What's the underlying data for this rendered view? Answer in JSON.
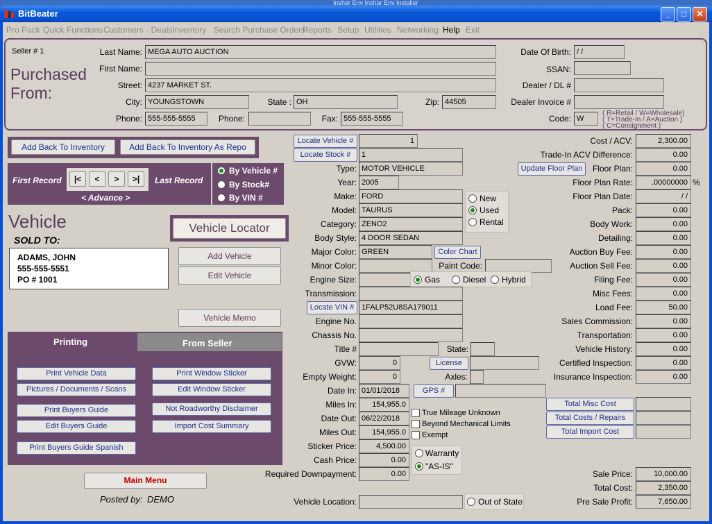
{
  "window": {
    "title": "BitBeater",
    "ghost_text": "Inshar Env     Inshar Env      Installer"
  },
  "menu": [
    "Pro Pack",
    "Quick Functions",
    "Customers - Deals",
    "Inventory",
    "Search Purchase Orders",
    "Reports",
    "Setup",
    "Utilities",
    "Networking",
    "Help",
    "Exit"
  ],
  "seller": {
    "seller_no": "Seller # 1",
    "purchased_from": "Purchased From:",
    "last_name_label": "Last Name:",
    "last_name": "MEGA AUTO AUCTION",
    "first_name_label": "First Name:",
    "first_name": "",
    "street_label": "Street:",
    "street": "4237 MARKET ST.",
    "city_label": "City:",
    "city": "YOUNGSTOWN",
    "state_label": "State :",
    "state": "OH",
    "zip_label": "Zip:",
    "zip": "44505",
    "phone_label": "Phone:",
    "phone": "555-555-5555",
    "phone2_label": "Phone:",
    "phone2": "",
    "fax_label": "Fax:",
    "fax": "555-555-5555",
    "dob_label": "Date Of Birth:",
    "dob": " / /",
    "ssan_label": "SSAN:",
    "ssan": "",
    "dealer_dl_label": "Dealer / DL #",
    "dealer_dl": "",
    "dealer_invoice_label": "Dealer Invoice #",
    "dealer_invoice": "",
    "code_label": "Code:",
    "code": "W",
    "code_hint1": "( R=Retail  /  W=Wholesale)",
    "code_hint2": "( T=Trade-In / A=Auction )",
    "code_hint3": "( C=Consignment )"
  },
  "left": {
    "add_back": "Add Back To Inventory",
    "add_back_repo": "Add Back To Inventory As Repo",
    "first_record": "First Record",
    "last_record": "Last Record",
    "advance": "< Advance >",
    "nav": [
      "|<",
      "<",
      ">",
      ">|"
    ],
    "by_vehicle": "By Vehicle #",
    "by_stock": "By Stock#",
    "by_vin": "By VIN #",
    "vehicle": "Vehicle",
    "sold_to": "SOLD TO:",
    "buyer_name": "ADAMS, JOHN",
    "buyer_phone": "555-555-5551",
    "buyer_po": "PO # 1001",
    "vehicle_locator": "Vehicle Locator",
    "add_vehicle": "Add Vehicle",
    "edit_vehicle": "Edit Vehicle",
    "vehicle_memo": "Vehicle Memo",
    "tab_printing": "Printing",
    "tab_from_seller": "From Seller",
    "print_buttons": [
      "Print Vehicle Data",
      "Print Window Sticker",
      "Pictures / Documents / Scans",
      "Edit Window Sticker",
      "Print Buyers Guide",
      "Not Roadworthy Disclaimer",
      "Edit Buyers Guide",
      "Import Cost Summary",
      "Print Buyers Guide Spanish"
    ],
    "main_menu": "Main Menu",
    "posted_by_label": "Posted by:",
    "posted_by": "DEMO"
  },
  "mid": {
    "locate_vehicle": "Locate Vehicle #",
    "vehicle_no": "1",
    "locate_stock": "Locate Stock #",
    "stock_no": "1",
    "type_label": "Type:",
    "type": "MOTOR VEHICLE",
    "year_label": "Year:",
    "year": "2005",
    "make_label": "Make:",
    "make": "FORD",
    "model_label": "Model:",
    "model": "TAURUS",
    "category_label": "Category:",
    "category": "ZENO2",
    "body_label": "Body Style:",
    "body": "4 DOOR SEDAN",
    "major_color_label": "Major Color:",
    "major_color": "GREEN",
    "color_chart": "Color Chart",
    "minor_color_label": "Minor Color:",
    "minor_color": "",
    "paint_code_label": "Paint Code:",
    "paint_code": "",
    "engine_size_label": "Engine Size:",
    "engine_size": "",
    "fuel": [
      "Gas",
      "Diesel",
      "Hybrid"
    ],
    "transmission_label": "Transmission:",
    "transmission": "",
    "locate_vin": "Locate VIN #",
    "vin": "1FALP52U8SA179011",
    "engine_no_label": "Engine No.",
    "engine_no": "",
    "chassis_label": "Chassis No.",
    "chassis": "",
    "title_label": "Title #",
    "title": "",
    "title_state_label": "State:",
    "title_state": "",
    "gvw_label": "GVW:",
    "gvw": "0",
    "license": "License",
    "license_val": "",
    "empty_weight_label": "Empty Weight:",
    "empty_weight": "0",
    "axles_label": "Axles:",
    "axles": "",
    "date_in_label": "Date In:",
    "date_in": "01/01/2018",
    "gps": "GPS #",
    "gps_val": "",
    "miles_in_label": "Miles In:",
    "miles_in": "154,955.0",
    "date_out_label": "Date Out:",
    "date_out": "06/22/2018",
    "miles_out_label": "Miles Out:",
    "miles_out": "154,955.0",
    "sticker_label": "Sticker Price:",
    "sticker": "4,500.00",
    "cash_label": "Cash Price:",
    "cash": "0.00",
    "downpay_label": "Required Downpayment:",
    "downpay": "0.00",
    "location_label": "Vehicle Location:",
    "location": "",
    "out_of_state": "Out of State",
    "cond": [
      "New",
      "Used",
      "Rental"
    ],
    "true_mileage": "True Mileage Unknown",
    "beyond_limits": "Beyond Mechanical Limits",
    "exempt": "Exempt",
    "warranty": "Warranty",
    "as_is": "\"AS-IS\"",
    "update_floor": "Update Floor Plan"
  },
  "costs": {
    "rows": [
      {
        "label": "Cost / ACV:",
        "value": "2,300.00"
      },
      {
        "label": "Trade-In ACV Difference:",
        "value": "0.00"
      },
      {
        "label": "Floor Plan:",
        "value": "0.00"
      },
      {
        "label": "Floor Plan Rate:",
        "value": ".00000000"
      },
      {
        "label": "Floor Plan Date:",
        "value": " / /"
      },
      {
        "label": "Pack:",
        "value": "0.00"
      },
      {
        "label": "Body Work:",
        "value": "0.00"
      },
      {
        "label": "Detailing:",
        "value": "0.00"
      },
      {
        "label": "Auction Buy Fee:",
        "value": "0.00"
      },
      {
        "label": "Auction Sell Fee:",
        "value": "0.00"
      },
      {
        "label": "Filing Fee:",
        "value": "0.00"
      },
      {
        "label": "Misc Fees:",
        "value": "0.00"
      },
      {
        "label": "Load Fee:",
        "value": "50.00"
      },
      {
        "label": "Sales Commission:",
        "value": "0.00"
      },
      {
        "label": "Transportation:",
        "value": "0.00"
      },
      {
        "label": "Vehicle History:",
        "value": "0.00"
      },
      {
        "label": "Certified Inspection:",
        "value": "0.00"
      },
      {
        "label": "Insurance Inspection:",
        "value": "0.00"
      }
    ],
    "pct": "%",
    "total_misc": "Total Misc Cost",
    "total_misc_val": "",
    "total_costs": "Total Costs / Repairs",
    "total_costs_val": "",
    "total_import": "Total Import Cost",
    "total_import_val": "",
    "sale_price_label": "Sale Price:",
    "sale_price": "10,000.00",
    "total_cost_label": "Total Cost:",
    "total_cost": "2,350.00",
    "pre_sale_label": "Pre Sale Profit:",
    "pre_sale": "7,650.00"
  }
}
